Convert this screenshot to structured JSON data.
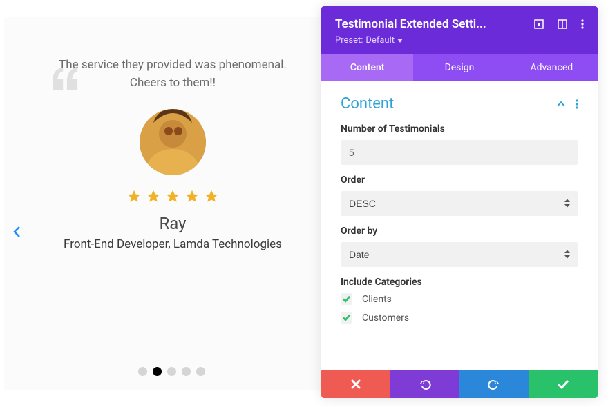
{
  "testimonial": {
    "text": "The service they provided was phenomenal. Cheers to them!!",
    "author": "Ray",
    "title": "Front-End Developer, Lamda Technologies",
    "rating": 5,
    "slides": 5,
    "active_slide": 1
  },
  "panel": {
    "title": "Testimonial Extended Setti...",
    "preset_label": "Preset:",
    "preset_value": "Default",
    "tabs": [
      "Content",
      "Design",
      "Advanced"
    ],
    "active_tab": 0,
    "section_title": "Content",
    "fields": {
      "num_label": "Number of Testimonials",
      "num_value": "5",
      "order_label": "Order",
      "order_value": "DESC",
      "orderby_label": "Order by",
      "orderby_value": "Date",
      "categories_label": "Include Categories",
      "categories": [
        "Clients",
        "Customers"
      ]
    }
  }
}
